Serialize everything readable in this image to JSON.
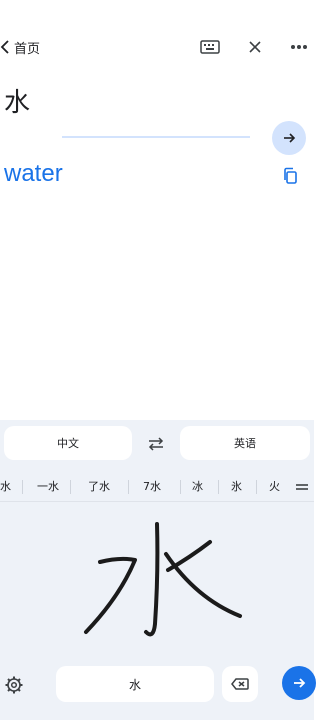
{
  "header": {
    "back_label": "首页",
    "icons": {
      "back": "chevron-left-icon",
      "keyboard": "keyboard-icon",
      "close": "close-icon",
      "more": "more-horizontal-icon"
    }
  },
  "input": {
    "source_text": "水"
  },
  "result": {
    "translation": "water"
  },
  "keyboard": {
    "source_lang": "中文",
    "target_lang": "英语",
    "candidates": [
      "水",
      "一水",
      "了水",
      "7水",
      "冰",
      "氷",
      "火"
    ],
    "preview_text": "水"
  },
  "colors": {
    "accent": "#1a73e8",
    "accent_light": "#d3e3fd",
    "panel_bg": "#eef2f8"
  }
}
